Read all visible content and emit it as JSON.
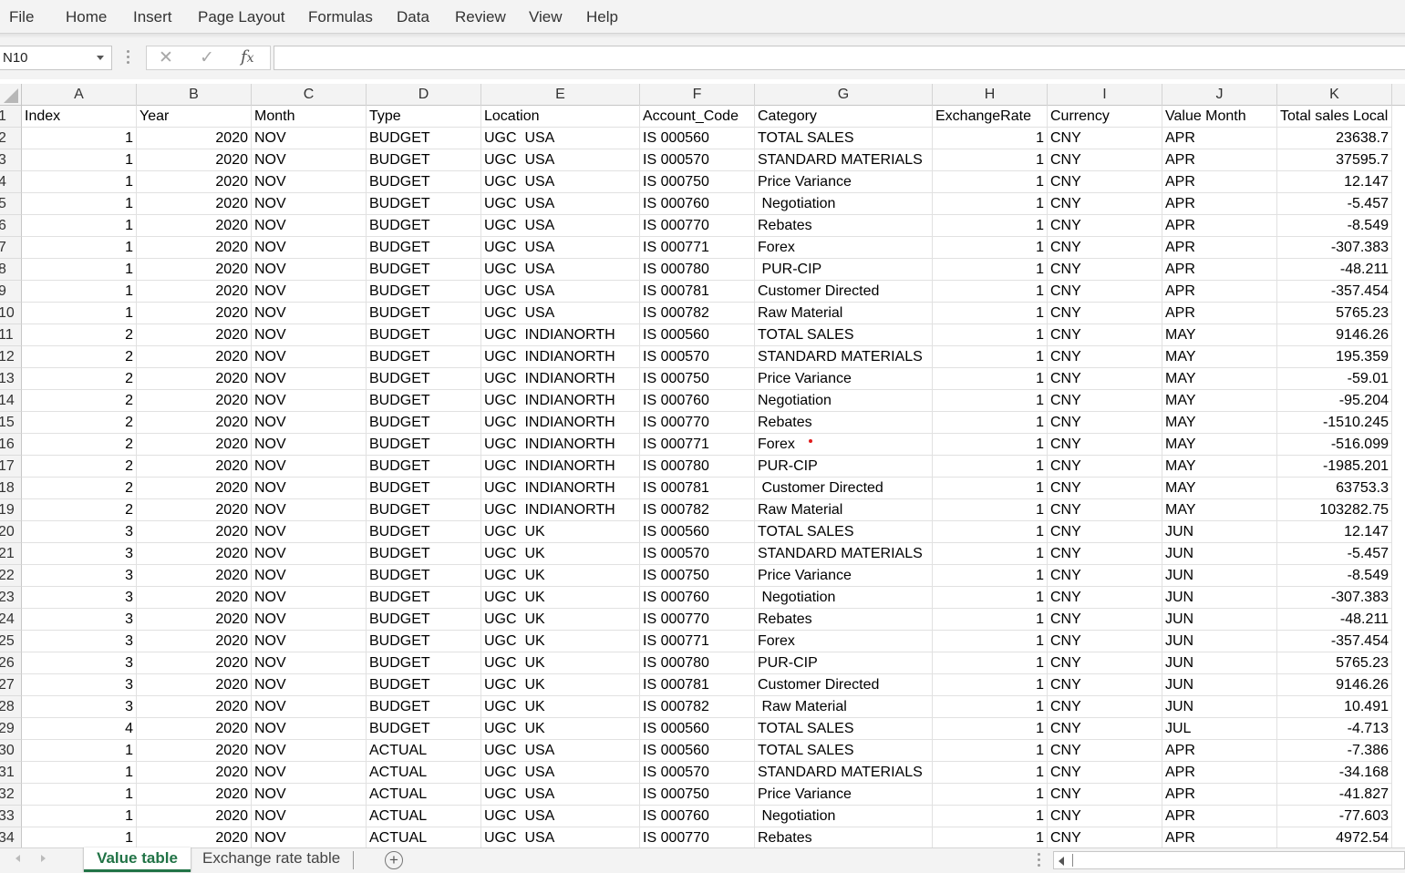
{
  "menu": [
    "File",
    "Home",
    "Insert",
    "Page Layout",
    "Formulas",
    "Data",
    "Review",
    "View",
    "Help"
  ],
  "name_box": "N10",
  "formula_bar": {
    "cancel_glyph": "✕",
    "enter_glyph": "✓",
    "fx_glyph": "fx",
    "value": ""
  },
  "columns": [
    "A",
    "B",
    "C",
    "D",
    "E",
    "F",
    "G",
    "H",
    "I",
    "J",
    "K"
  ],
  "headers": [
    "Index",
    "Year",
    "Month",
    "Type",
    "Location",
    "Account_Code",
    "Category",
    "ExchangeRate",
    "Currency",
    "Value Month",
    "Total sales Local"
  ],
  "rows": [
    [
      "1",
      "2020",
      "NOV",
      "BUDGET",
      "UGC  USA",
      "IS 000560",
      "TOTAL SALES",
      "1",
      "CNY",
      "APR",
      "23638.7"
    ],
    [
      "1",
      "2020",
      "NOV",
      "BUDGET",
      "UGC  USA",
      "IS 000570",
      "STANDARD MATERIALS",
      "1",
      "CNY",
      "APR",
      "37595.7"
    ],
    [
      "1",
      "2020",
      "NOV",
      "BUDGET",
      "UGC  USA",
      "IS 000750",
      "Price Variance",
      "1",
      "CNY",
      "APR",
      "12.147"
    ],
    [
      "1",
      "2020",
      "NOV",
      "BUDGET",
      "UGC  USA",
      "IS 000760",
      " Negotiation",
      "1",
      "CNY",
      "APR",
      "-5.457"
    ],
    [
      "1",
      "2020",
      "NOV",
      "BUDGET",
      "UGC  USA",
      "IS 000770",
      "Rebates",
      "1",
      "CNY",
      "APR",
      "-8.549"
    ],
    [
      "1",
      "2020",
      "NOV",
      "BUDGET",
      "UGC  USA",
      "IS 000771",
      "Forex",
      "1",
      "CNY",
      "APR",
      "-307.383"
    ],
    [
      "1",
      "2020",
      "NOV",
      "BUDGET",
      "UGC  USA",
      "IS 000780",
      " PUR-CIP",
      "1",
      "CNY",
      "APR",
      "-48.211"
    ],
    [
      "1",
      "2020",
      "NOV",
      "BUDGET",
      "UGC  USA",
      "IS 000781",
      "Customer Directed",
      "1",
      "CNY",
      "APR",
      "-357.454"
    ],
    [
      "1",
      "2020",
      "NOV",
      "BUDGET",
      "UGC  USA",
      "IS 000782",
      "Raw Material",
      "1",
      "CNY",
      "APR",
      "5765.23"
    ],
    [
      "2",
      "2020",
      "NOV",
      "BUDGET",
      "UGC  INDIANORTH",
      "IS 000560",
      "TOTAL SALES",
      "1",
      "CNY",
      "MAY",
      "9146.26"
    ],
    [
      "2",
      "2020",
      "NOV",
      "BUDGET",
      "UGC  INDIANORTH",
      "IS 000570",
      "STANDARD MATERIALS",
      "1",
      "CNY",
      "MAY",
      "195.359"
    ],
    [
      "2",
      "2020",
      "NOV",
      "BUDGET",
      "UGC  INDIANORTH",
      "IS 000750",
      "Price Variance",
      "1",
      "CNY",
      "MAY",
      "-59.01"
    ],
    [
      "2",
      "2020",
      "NOV",
      "BUDGET",
      "UGC  INDIANORTH",
      "IS 000760",
      "Negotiation",
      "1",
      "CNY",
      "MAY",
      "-95.204"
    ],
    [
      "2",
      "2020",
      "NOV",
      "BUDGET",
      "UGC  INDIANORTH",
      "IS 000770",
      "Rebates",
      "1",
      "CNY",
      "MAY",
      "-1510.245"
    ],
    [
      "2",
      "2020",
      "NOV",
      "BUDGET",
      "UGC  INDIANORTH",
      "IS 000771",
      "Forex",
      "1",
      "CNY",
      "MAY",
      "-516.099"
    ],
    [
      "2",
      "2020",
      "NOV",
      "BUDGET",
      "UGC  INDIANORTH",
      "IS 000780",
      "PUR-CIP",
      "1",
      "CNY",
      "MAY",
      "-1985.201"
    ],
    [
      "2",
      "2020",
      "NOV",
      "BUDGET",
      "UGC  INDIANORTH",
      "IS 000781",
      " Customer Directed",
      "1",
      "CNY",
      "MAY",
      "63753.3"
    ],
    [
      "2",
      "2020",
      "NOV",
      "BUDGET",
      "UGC  INDIANORTH",
      "IS 000782",
      "Raw Material",
      "1",
      "CNY",
      "MAY",
      "103282.75"
    ],
    [
      "3",
      "2020",
      "NOV",
      "BUDGET",
      "UGC  UK",
      "IS 000560",
      "TOTAL SALES",
      "1",
      "CNY",
      "JUN",
      "12.147"
    ],
    [
      "3",
      "2020",
      "NOV",
      "BUDGET",
      "UGC  UK",
      "IS 000570",
      "STANDARD MATERIALS",
      "1",
      "CNY",
      "JUN",
      "-5.457"
    ],
    [
      "3",
      "2020",
      "NOV",
      "BUDGET",
      "UGC  UK",
      "IS 000750",
      "Price Variance",
      "1",
      "CNY",
      "JUN",
      "-8.549"
    ],
    [
      "3",
      "2020",
      "NOV",
      "BUDGET",
      "UGC  UK",
      "IS 000760",
      " Negotiation",
      "1",
      "CNY",
      "JUN",
      "-307.383"
    ],
    [
      "3",
      "2020",
      "NOV",
      "BUDGET",
      "UGC  UK",
      "IS 000770",
      "Rebates",
      "1",
      "CNY",
      "JUN",
      "-48.211"
    ],
    [
      "3",
      "2020",
      "NOV",
      "BUDGET",
      "UGC  UK",
      "IS 000771",
      "Forex",
      "1",
      "CNY",
      "JUN",
      "-357.454"
    ],
    [
      "3",
      "2020",
      "NOV",
      "BUDGET",
      "UGC  UK",
      "IS 000780",
      "PUR-CIP",
      "1",
      "CNY",
      "JUN",
      "5765.23"
    ],
    [
      "3",
      "2020",
      "NOV",
      "BUDGET",
      "UGC  UK",
      "IS 000781",
      "Customer Directed",
      "1",
      "CNY",
      "JUN",
      "9146.26"
    ],
    [
      "3",
      "2020",
      "NOV",
      "BUDGET",
      "UGC  UK",
      "IS 000782",
      " Raw Material",
      "1",
      "CNY",
      "JUN",
      "10.491"
    ],
    [
      "4",
      "2020",
      "NOV",
      "BUDGET",
      "UGC  UK",
      "IS 000560",
      "TOTAL SALES",
      "1",
      "CNY",
      "JUL",
      "-4.713"
    ],
    [
      "1",
      "2020",
      "NOV",
      "ACTUAL",
      "UGC  USA",
      "IS 000560",
      "TOTAL SALES",
      "1",
      "CNY",
      "APR",
      "-7.386"
    ],
    [
      "1",
      "2020",
      "NOV",
      "ACTUAL",
      "UGC  USA",
      "IS 000570",
      "STANDARD MATERIALS",
      "1",
      "CNY",
      "APR",
      "-34.168"
    ],
    [
      "1",
      "2020",
      "NOV",
      "ACTUAL",
      "UGC  USA",
      "IS 000750",
      "Price Variance",
      "1",
      "CNY",
      "APR",
      "-41.827"
    ],
    [
      "1",
      "2020",
      "NOV",
      "ACTUAL",
      "UGC  USA",
      "IS 000760",
      " Negotiation",
      "1",
      "CNY",
      "APR",
      "-77.603"
    ],
    [
      "1",
      "2020",
      "NOV",
      "ACTUAL",
      "UGC  USA",
      "IS 000770",
      "Rebates",
      "1",
      "CNY",
      "APR",
      "4972.54"
    ]
  ],
  "sheet_tabs": {
    "active": "Value table",
    "inactive": "Exchange rate table",
    "add_glyph": "+"
  },
  "colors": {
    "accent": "#217346",
    "note_marker": "#e01b1b"
  }
}
